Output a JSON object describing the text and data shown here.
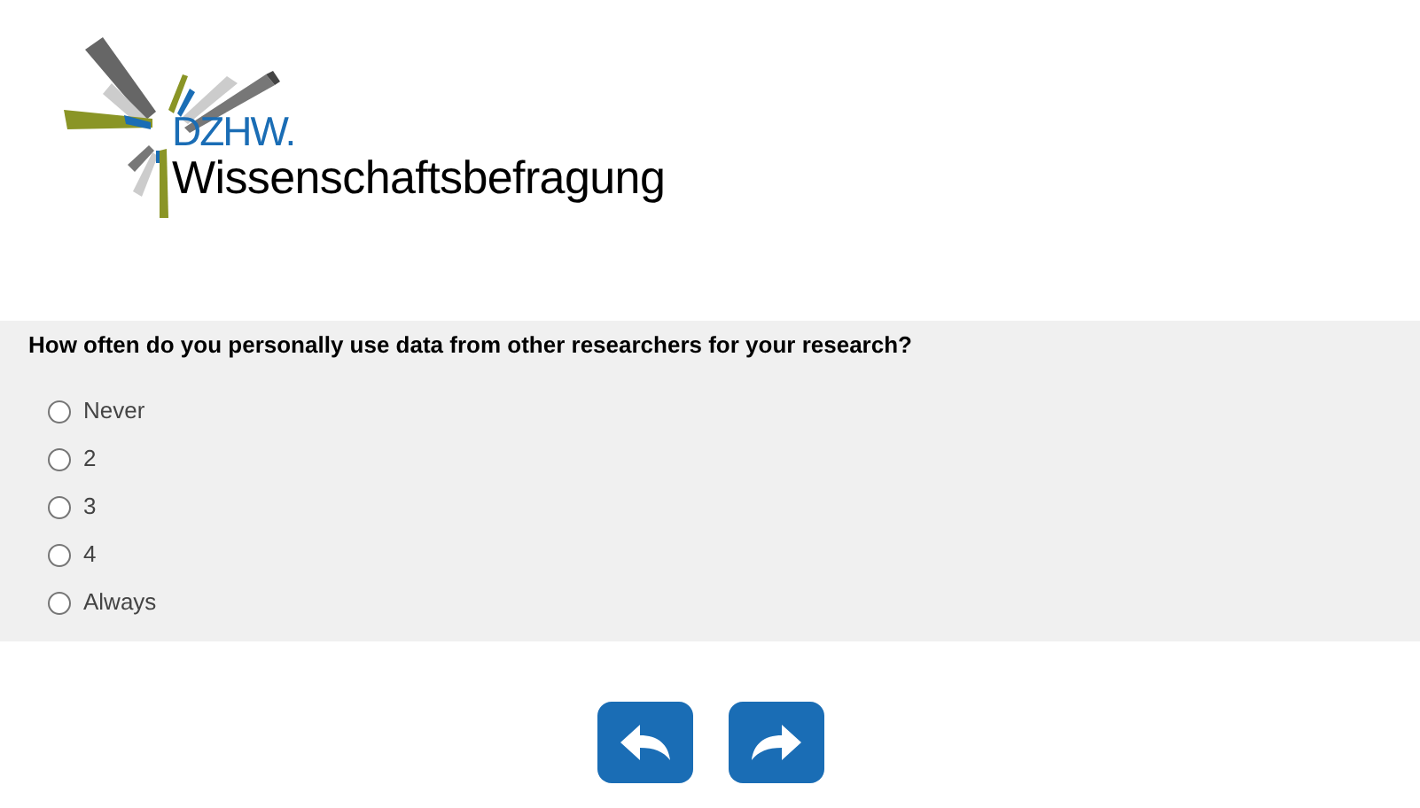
{
  "logo": {
    "brand": "DZHW.",
    "name": "Wissenschaftsbefragung"
  },
  "question": {
    "text": "How often do you personally use data from other researchers for your research?",
    "options": [
      {
        "label": "Never",
        "selected": false
      },
      {
        "label": "2",
        "selected": false
      },
      {
        "label": "3",
        "selected": false
      },
      {
        "label": "4",
        "selected": false
      },
      {
        "label": "Always",
        "selected": false
      }
    ]
  },
  "navigation": [
    {
      "kind": "back"
    },
    {
      "kind": "next"
    }
  ]
}
